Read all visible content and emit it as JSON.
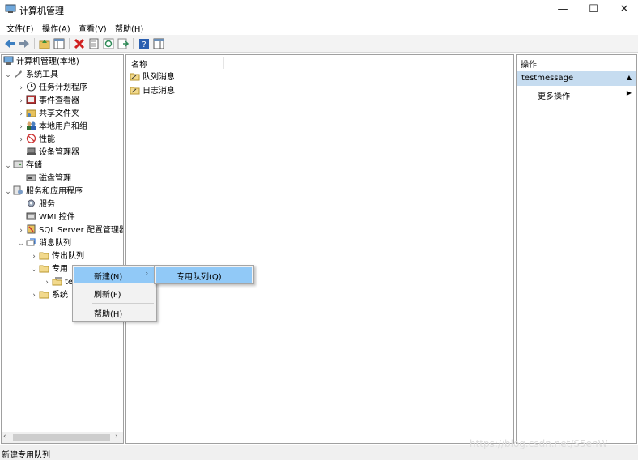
{
  "window": {
    "title": "计算机管理",
    "minimize": "—",
    "maximize": "☐",
    "close": "✕"
  },
  "menu": [
    "文件(F)",
    "操作(A)",
    "查看(V)",
    "帮助(H)"
  ],
  "tree": {
    "root": "计算机管理(本地)",
    "system_tools": "系统工具",
    "task_scheduler": "任务计划程序",
    "event_viewer": "事件查看器",
    "shared_folders": "共享文件夹",
    "local_users": "本地用户和组",
    "performance": "性能",
    "device_manager": "设备管理器",
    "storage": "存储",
    "disk_management": "磁盘管理",
    "services_apps": "服务和应用程序",
    "services": "服务",
    "wmi_control": "WMI 控件",
    "sql_server": "SQL Server 配置管理器",
    "message_queuing": "消息队列",
    "outgoing_queues": "传出队列",
    "private_queues": "专用",
    "private_child": "te",
    "system_queues": "系统"
  },
  "list": {
    "column_name": "名称",
    "items": [
      "队列消息",
      "日志消息"
    ]
  },
  "actions": {
    "header": "操作",
    "section": "testmessage",
    "more": "更多操作"
  },
  "context_menu": {
    "new": "新建(N)",
    "refresh": "刷新(F)",
    "help": "帮助(H)",
    "submenu_private_queue": "专用队列(Q)"
  },
  "status": "新建专用队列",
  "watermark": "https://blog.csdn.net/S5enW",
  "colors": {
    "highlight": "#91c9f7",
    "section_bg": "#c6dcf0"
  }
}
